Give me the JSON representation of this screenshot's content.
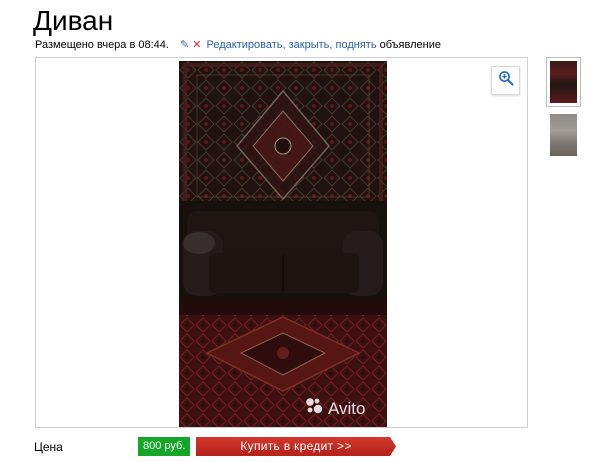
{
  "listing": {
    "title": "Диван",
    "posted": "Размещено вчера в 08:44.",
    "actions_link": "Редактировать, закрыть, поднять",
    "actions_suffix": " объявление"
  },
  "gallery": {
    "watermark": "Avito",
    "zoom_icon": "zoom-in-icon",
    "thumbnails": [
      "photo-1",
      "photo-2"
    ]
  },
  "price": {
    "label": "Цена",
    "value": "800 руб.",
    "credit_button": "Купить в кредит >>"
  },
  "colors": {
    "link": "#2a5ea8",
    "price_badge": "#13a629",
    "credit_button": "#c72c24",
    "close": "#d22b2b"
  }
}
